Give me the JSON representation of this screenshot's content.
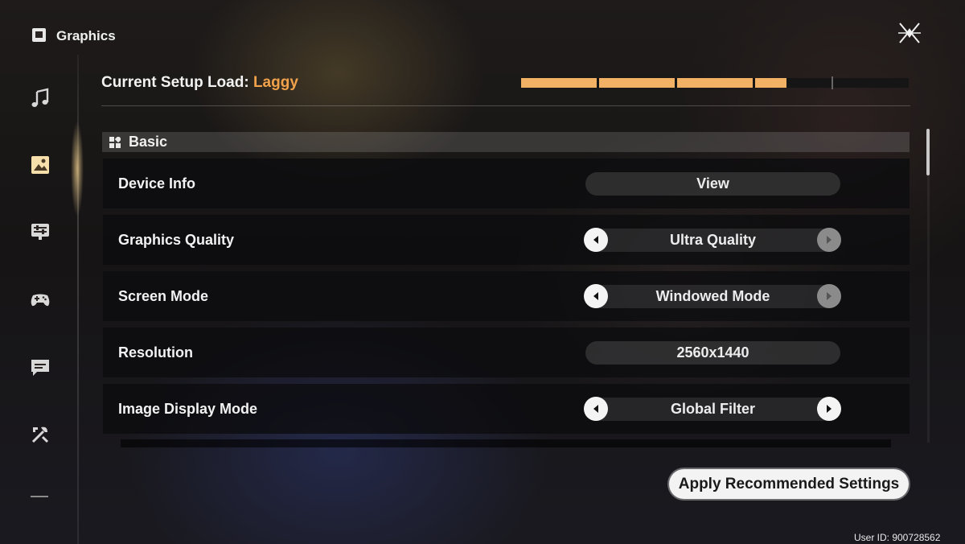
{
  "header": {
    "title": "Graphics",
    "icon": "graphics-icon"
  },
  "sidebar": {
    "items": [
      {
        "icon": "music-note-icon"
      },
      {
        "icon": "graphics-icon",
        "active": true
      },
      {
        "icon": "sliders-icon"
      },
      {
        "icon": "gamepad-icon"
      },
      {
        "icon": "chat-icon"
      },
      {
        "icon": "wrench-ruler-icon"
      }
    ]
  },
  "setup_load": {
    "label": "Current Setup Load:",
    "value": "Laggy",
    "value_color": "#f2a24a",
    "filled_segments": 4,
    "total_segments": 5
  },
  "section": {
    "title": "Basic"
  },
  "rows": {
    "device_info": {
      "label": "Device Info",
      "button": "View"
    },
    "graphics_quality": {
      "label": "Graphics Quality",
      "value": "Ultra Quality"
    },
    "screen_mode": {
      "label": "Screen Mode",
      "value": "Windowed Mode"
    },
    "resolution": {
      "label": "Resolution",
      "value": "2560x1440"
    },
    "image_display_mode": {
      "label": "Image Display Mode",
      "value": "Global Filter"
    }
  },
  "apply_button": {
    "label": "Apply Recommended Settings"
  },
  "user_id": "User ID: 900728562",
  "colors": {
    "accent": "#f2b165",
    "row_bg": "#0c0c0e"
  }
}
